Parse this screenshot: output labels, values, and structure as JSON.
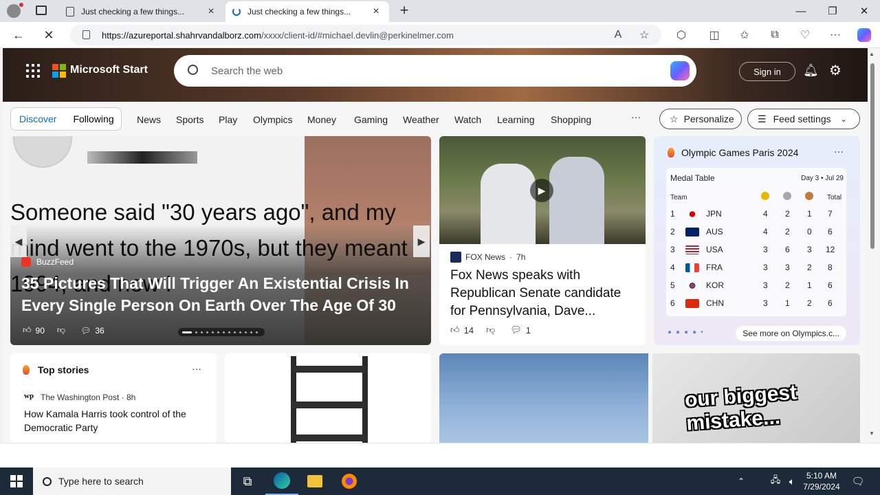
{
  "browser": {
    "tabs": [
      {
        "title": "Just checking a few things...",
        "active": false
      },
      {
        "title": "Just checking a few things...",
        "active": true
      }
    ],
    "url_domain": "https://azureportal.shahrvandalborz.com",
    "url_path": "/xxxx/client-id/#michael.devlin@perkinelmer.com"
  },
  "msn": {
    "brand": "Microsoft Start",
    "search_placeholder": "Search the web",
    "sign_in": "Sign in",
    "segments": [
      "Discover",
      "Following"
    ],
    "nav": [
      "News",
      "Sports",
      "Play",
      "Olympics",
      "Money",
      "Gaming",
      "Weather",
      "Watch",
      "Learning",
      "Shopping"
    ],
    "more": "···",
    "personalize": "Personalize",
    "feed_settings": "Feed settings"
  },
  "carousel": {
    "image_text": "Someone said \"30 years ago\", and my mind went to the 1970s, but they meant 1994, and now I",
    "source": "BuzzFeed",
    "title": "35 Pictures That Will Trigger An Existential Crisis In Every Single Person On Earth Over The Age Of 30",
    "likes": "90",
    "comments": "36"
  },
  "fox": {
    "source": "FOX News",
    "age": "7h",
    "title": "Fox News speaks with Republican Senate candidate for Pennsylvania, Dave...",
    "likes": "14",
    "comments": "1"
  },
  "olympics": {
    "title": "Olympic Games Paris 2024",
    "table_title": "Medal Table",
    "day": "Day 3 • Jul 29",
    "headers": {
      "team": "Team",
      "total": "Total"
    },
    "rows": [
      {
        "rank": "1",
        "team": "JPN",
        "gold": "4",
        "silver": "2",
        "bronze": "1",
        "total": "7"
      },
      {
        "rank": "2",
        "team": "AUS",
        "gold": "4",
        "silver": "2",
        "bronze": "0",
        "total": "6"
      },
      {
        "rank": "3",
        "team": "USA",
        "gold": "3",
        "silver": "6",
        "bronze": "3",
        "total": "12"
      },
      {
        "rank": "4",
        "team": "FRA",
        "gold": "3",
        "silver": "3",
        "bronze": "2",
        "total": "8"
      },
      {
        "rank": "5",
        "team": "KOR",
        "gold": "3",
        "silver": "2",
        "bronze": "1",
        "total": "6"
      },
      {
        "rank": "6",
        "team": "CHN",
        "gold": "3",
        "silver": "1",
        "bronze": "2",
        "total": "6"
      }
    ],
    "see_more": "See more on Olympics.c..."
  },
  "top_stories": {
    "title": "Top stories",
    "source": "The Washington Post · 8h",
    "headline": "How Kamala Harris took control of the Democratic Party"
  },
  "mistake_text": "our biggest mistake...",
  "taskbar": {
    "search_placeholder": "Type here to search",
    "time": "5:10 AM",
    "date": "7/29/2024"
  }
}
